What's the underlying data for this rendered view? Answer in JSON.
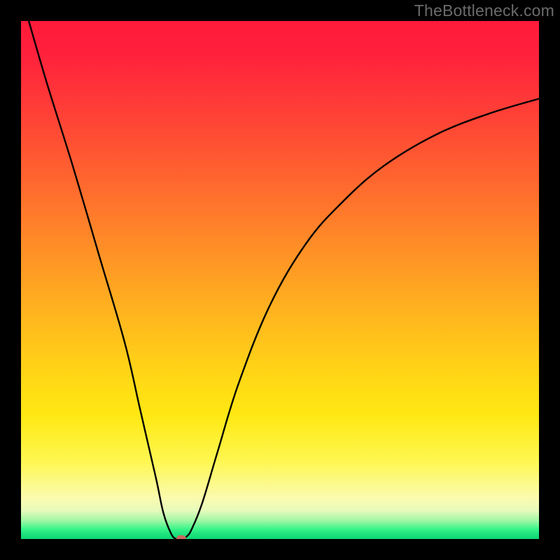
{
  "watermark": "TheBottleneck.com",
  "chart_data": {
    "type": "line",
    "title": "",
    "xlabel": "",
    "ylabel": "",
    "xlim": [
      0,
      100
    ],
    "ylim": [
      0,
      100
    ],
    "grid": false,
    "legend": false,
    "series": [
      {
        "name": "curve",
        "x": [
          1.5,
          5,
          10,
          15,
          20,
          23,
          26,
          27.5,
          29,
          30,
          31,
          32,
          33,
          35,
          38,
          42,
          48,
          55,
          62,
          70,
          80,
          90,
          100
        ],
        "values": [
          100,
          88,
          72,
          55,
          38,
          25,
          12,
          5,
          1,
          0,
          0,
          0.5,
          2,
          7,
          17,
          30,
          45,
          57,
          65,
          72,
          78,
          82,
          85
        ]
      }
    ],
    "marker": {
      "x": 31,
      "y": 0,
      "name": "optimal-point"
    },
    "background": "rainbow-vertical-gradient"
  }
}
